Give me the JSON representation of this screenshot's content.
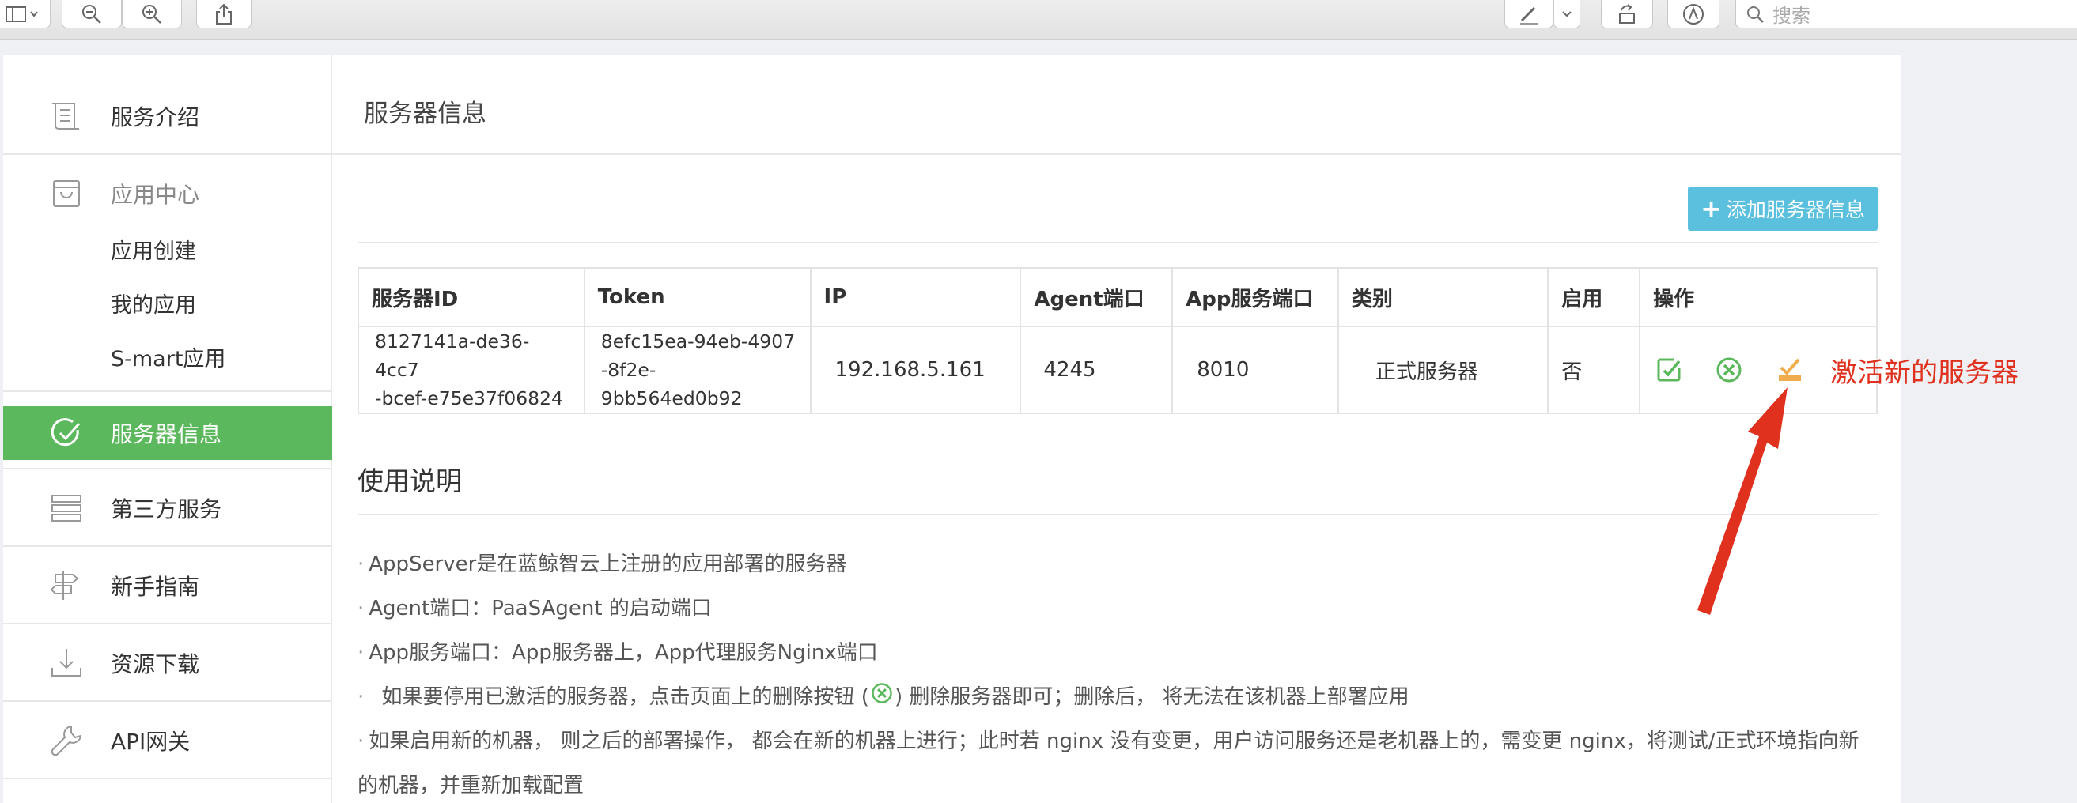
{
  "toolbar": {
    "search_placeholder": "搜索"
  },
  "sidebar": {
    "items": [
      {
        "label": "服务介绍"
      },
      {
        "label": "应用中心"
      },
      {
        "label": "服务器信息"
      },
      {
        "label": "第三方服务"
      },
      {
        "label": "新手指南"
      },
      {
        "label": "资源下载"
      },
      {
        "label": "API网关"
      }
    ],
    "subitems": [
      {
        "label": "应用创建"
      },
      {
        "label": "我的应用"
      },
      {
        "label": "S-mart应用"
      }
    ]
  },
  "main": {
    "title": "服务器信息",
    "add_button_label": "添加服务器信息",
    "table": {
      "headers": [
        "服务器ID",
        "Token",
        "IP",
        "Agent端口",
        "App服务端口",
        "类别",
        "启用",
        "操作"
      ],
      "rows": [
        {
          "server_id_line1": "8127141a-de36-4cc7",
          "server_id_line2": "-bcef-e75e37f06824",
          "token_line1": "8efc15ea-94eb-4907",
          "token_line2": "-8f2e-9bb564ed0b92",
          "ip": "192.168.5.161",
          "agent_port": "4245",
          "app_port": "8010",
          "category": "正式服务器",
          "enabled": "否"
        }
      ]
    },
    "usage": {
      "title": "使用说明",
      "items": [
        "AppServer是在蓝鲸智云上注册的应用部署的服务器",
        "Agent端口：PaaSAgent 的启动端口",
        "App服务端口：App服务器上，App代理服务Nginx端口",
        "如果要停用已激活的服务器，点击页面上的删除按钮 (",
        ") 删除服务器即可；删除后， 将无法在该机器上部署应用",
        "如果启用新的机器， 则之后的部署操作， 都会在新的机器上进行；此时若 nginx 没有变更，用户访问服务还是老机器上的，需变更 nginx，将测试/正式环境指向新",
        "的机器，并重新加载配置"
      ]
    }
  },
  "annotation": {
    "text": "激活新的服务器",
    "color": "#e0301e"
  },
  "colors": {
    "active_green": "#5cb85c",
    "info_blue": "#5bc0de",
    "warning_orange": "#f0ad4e"
  }
}
